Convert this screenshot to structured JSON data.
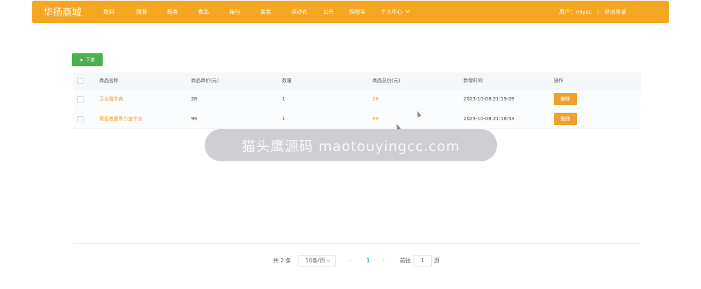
{
  "header": {
    "brand": "华扬商城",
    "nav": [
      {
        "label": "数码"
      },
      {
        "label": "服装"
      },
      {
        "label": "鞋类"
      },
      {
        "label": "食品"
      },
      {
        "label": "箱包"
      },
      {
        "label": "美妆"
      },
      {
        "label": "运动衣"
      },
      {
        "label": "公告"
      },
      {
        "label": "购物车"
      },
      {
        "label": "个人中心"
      }
    ],
    "user_label": "用户：mlycc",
    "separator": "|",
    "logout_label": "退出登录"
  },
  "toolbar": {
    "order_label": "下单"
  },
  "table": {
    "columns": [
      "商品名称",
      "商品单价(元)",
      "数量",
      "商品总价(元)",
      "新增时间",
      "操作"
    ],
    "rows": [
      {
        "name": "卫龙魔芋爽",
        "price": "28",
        "qty": "1",
        "total": "28",
        "time": "2023-10-08 21:19:09",
        "action": "删除"
      },
      {
        "name": "探拓者夏季力速干衣",
        "price": "99",
        "qty": "1",
        "total": "99",
        "time": "2023-10-08 21:18:53",
        "action": "删除"
      }
    ]
  },
  "watermark": {
    "text": "猫头鹰源码 maotouyingcc.com"
  },
  "pagination": {
    "total": "共 2 条",
    "page_size": "10条/页",
    "prev": "‹",
    "current": "1",
    "next": "›",
    "goto_label": "前往",
    "goto_value": "1",
    "goto_unit": "页"
  },
  "colors": {
    "header_bg": "#f5a623",
    "order_button": "#4caf50",
    "delete_button": "#f0a030",
    "active_page": "#409eff"
  }
}
